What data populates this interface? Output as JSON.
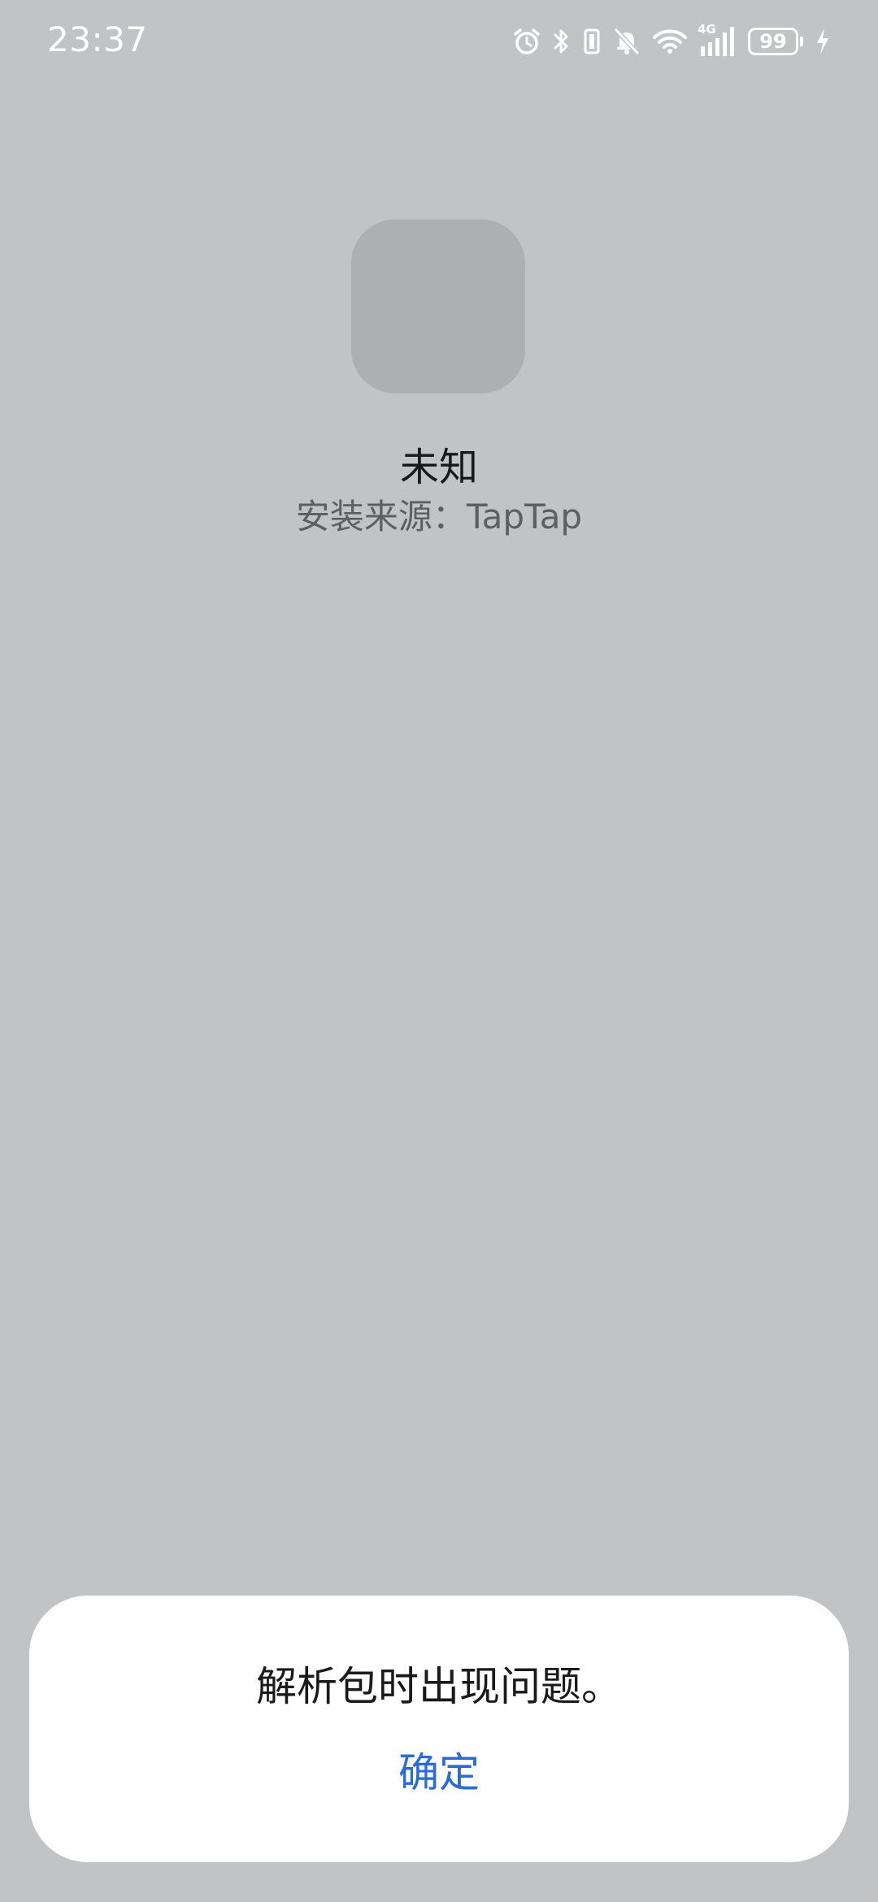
{
  "status_bar": {
    "time": "23:37",
    "network": "4G",
    "battery_level": "99",
    "icons": [
      "alarm-icon",
      "bluetooth-icon",
      "vibrate-icon",
      "mute-icon",
      "wifi-icon",
      "cellular-signal-icon",
      "battery-icon",
      "charging-icon"
    ]
  },
  "app": {
    "name": "未知",
    "source": "安装来源：TapTap"
  },
  "dialog": {
    "message": "解析包时出现问题。",
    "ok_label": "确定"
  },
  "colors": {
    "background": "#c2c3c5",
    "accent": "#2c6bd6",
    "dialog_background": "#ffffff",
    "icon_placeholder": "#aeafb1"
  }
}
